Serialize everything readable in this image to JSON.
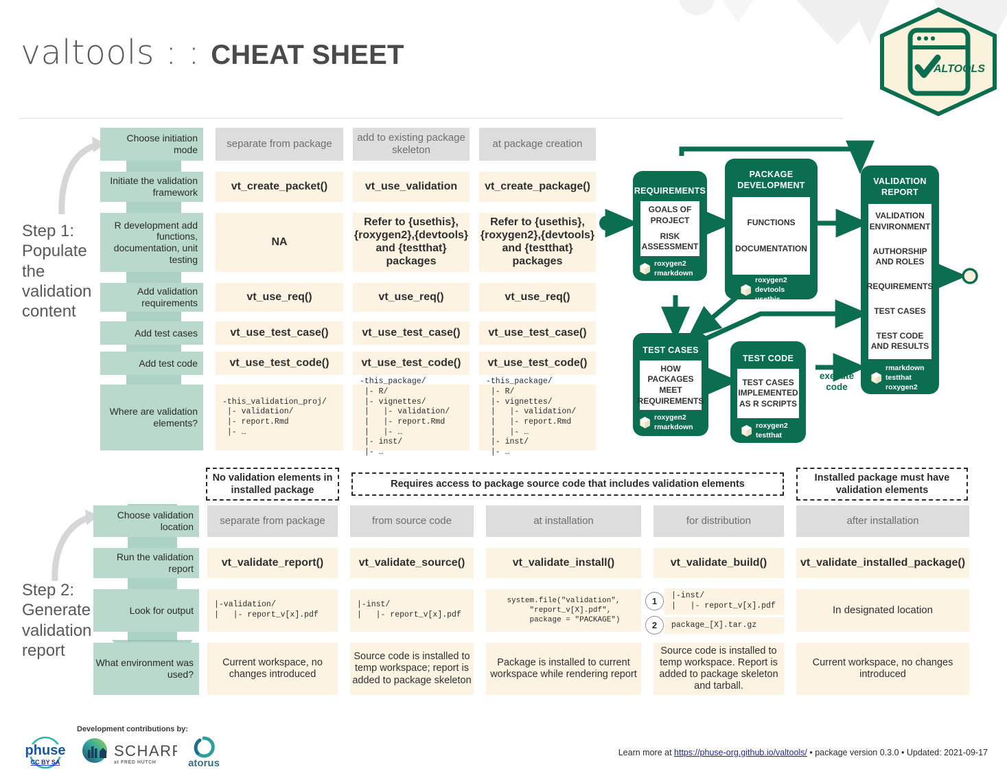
{
  "header": {
    "title_light": "valtools : : ",
    "title_bold": "CHEAT SHEET"
  },
  "logo": {
    "wordmark": "ALTOOLS",
    "name": "valtools-hex-logo"
  },
  "step1": {
    "caption": "Step 1:\nPopulate\nthe\nvalidation\ncontent",
    "row_labels": [
      "Choose initiation mode",
      "Initiate the validation framework",
      "R development add functions, documentation, unit testing",
      "Add validation requirements",
      "Add test cases",
      "Add test code",
      "Where are validation elements?"
    ],
    "columns": [
      {
        "mode": "separate from package",
        "initiate": "vt_create_packet()",
        "development": "NA",
        "requirements": "vt_use_req()",
        "test_cases": "vt_use_test_case()",
        "test_code": "vt_use_test_code()",
        "tree": "-this_validation_proj/\n |- validation/\n |- report.Rmd\n |- …"
      },
      {
        "mode": "add to existing package skeleton",
        "initiate": "vt_use_validation",
        "development": "Refer to {usethis}, {roxygen2},{devtools} and {testthat} packages",
        "requirements": "vt_use_req()",
        "test_cases": "vt_use_test_case()",
        "test_code": "vt_use_test_code()",
        "tree": "-this_package/\n |- R/\n |- vignettes/\n |   |- validation/\n |   |- report.Rmd\n |   |- …\n |- inst/\n |- …"
      },
      {
        "mode": "at package creation",
        "initiate": "vt_create_package()",
        "development": "Refer to {usethis}, {roxygen2},{devtools} and {testthat} packages",
        "requirements": "vt_use_req()",
        "test_cases": "vt_use_test_case()",
        "test_code": "vt_use_test_code()",
        "tree": "-this_package/\n |- R/\n |- vignettes/\n |   |- validation/\n |   |- report.Rmd\n |   |- …\n |- inst/\n |- …"
      }
    ]
  },
  "step2": {
    "caption": "Step 2:\nGenerate\nvalidation\nreport",
    "row_labels": [
      "Choose validation location",
      "Run the validation report",
      "Look for output",
      "What environment was used?"
    ],
    "group_headers": [
      "No validation elements in installed package",
      "Requires access to package source code that includes validation elements",
      "Installed package must have validation elements"
    ],
    "columns": [
      {
        "location": "separate from package",
        "run": "vt_validate_report()",
        "output": "|-validation/\n|   |- report_v[x].pdf",
        "environment": "Current workspace, no changes introduced"
      },
      {
        "location": "from source code",
        "run": "vt_validate_source()",
        "output": "|-inst/\n|   |- report_v[x].pdf",
        "environment": "Source code is installed to temp workspace; report is added to package skeleton"
      },
      {
        "location": "at installation",
        "run": "vt_validate_install()",
        "output": "system.file(\"validation\",\n     \"report_v[X].pdf\",\n     package = \"PACKAGE\")",
        "environment": "Package  is installed to current workspace while rendering report"
      },
      {
        "location": "for distribution",
        "run": "vt_validate_build()",
        "output_1": "|-inst/\n|   |- report_v[x].pdf",
        "output_2": "package_[X].tar.gz",
        "badge_1": "1",
        "badge_2": "2",
        "environment": "Source code is installed to temp workspace. Report is added to package skeleton and tarball."
      },
      {
        "location": "after installation",
        "run": "vt_validate_installed_package()",
        "output": "In designated location",
        "environment": "Current workspace, no changes introduced"
      }
    ]
  },
  "flowchart": {
    "nodes": [
      {
        "id": "requirements",
        "title": "REQUIREMENTS",
        "inner": [
          "GOALS OF PROJECT",
          "RISK ASSESSMENT"
        ],
        "packages": [
          "roxygen2",
          "rmarkdown"
        ]
      },
      {
        "id": "package-development",
        "title": "PACKAGE DEVELOPMENT",
        "inner": [
          "FUNCTIONS",
          "DOCUMENTATION"
        ],
        "packages": [
          "roxygen2",
          "devtools",
          "usethis"
        ]
      },
      {
        "id": "validation-report",
        "title": "VALIDATION REPORT",
        "inner": [
          "VALIDATION ENVIRONMENT",
          "AUTHORSHIP AND ROLES",
          "REQUIREMENTS",
          "TEST CASES",
          "TEST CODE AND RESULTS"
        ],
        "packages": [
          "rmarkdown",
          "testthat",
          "roxygen2"
        ]
      },
      {
        "id": "test-cases",
        "title": "TEST CASES",
        "inner": [
          "HOW PACKAGES MEET REQUIREMENTS"
        ],
        "packages": [
          "roxygen2",
          "rmarkdown"
        ]
      },
      {
        "id": "test-code",
        "title": "TEST CODE",
        "inner": [
          "TEST CASES IMPLEMENTED AS R SCRIPTS"
        ],
        "packages": [
          "roxygen2",
          "testthat"
        ]
      }
    ],
    "edge_label": "execute code"
  },
  "footer": {
    "contrib_label": "Development contributions by:",
    "phuse_word": "phuse",
    "cc_label": "CC BY SA",
    "scharp_word": "SCHARP",
    "scharp_sub": "at FRED HUTCH",
    "atorus_word": "atorus",
    "learn_prefix": "Learn more at ",
    "learn_url": "https://phuse-org.github.io/valtools/",
    "learn_suffix": " • package version  0.3.0 • Updated: 2021-09-17"
  },
  "colors": {
    "green": "#0b6e4f",
    "label_green": "#b9d9cd",
    "arrow_green": "#8cc0ae",
    "cream": "#fcf3e2",
    "grey": "#dddddd"
  }
}
